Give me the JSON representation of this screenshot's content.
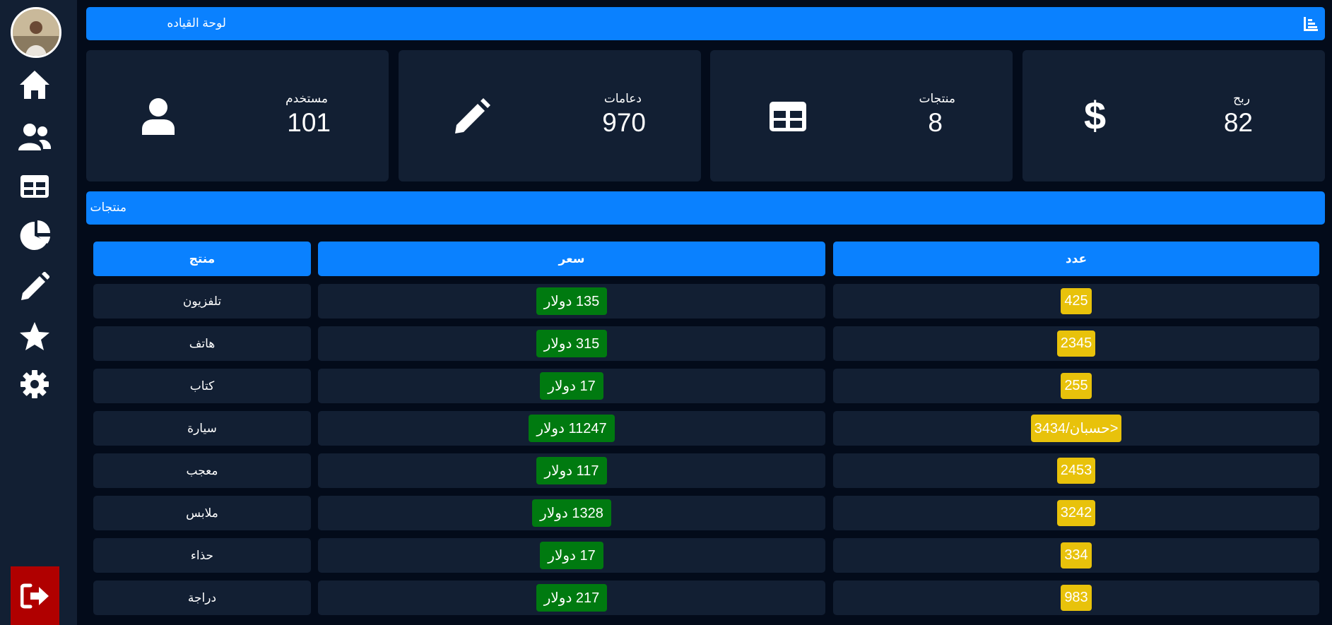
{
  "header": {
    "title": "لوحة القياده",
    "icon": "chart-bar-icon"
  },
  "sidebar": {
    "avatar": "user-avatar",
    "items": [
      {
        "icon": "home-icon"
      },
      {
        "icon": "users-icon"
      },
      {
        "icon": "table-icon"
      },
      {
        "icon": "pie-chart-icon"
      },
      {
        "icon": "pencil-icon"
      },
      {
        "icon": "star-icon"
      },
      {
        "icon": "gear-icon"
      }
    ],
    "logout_icon": "logout-icon"
  },
  "stats": [
    {
      "label": "مستخدم",
      "value": "101",
      "icon": "user-icon"
    },
    {
      "label": "دعامات",
      "value": "970",
      "icon": "pencil-icon"
    },
    {
      "label": "منتجات",
      "value": "8",
      "icon": "table-icon"
    },
    {
      "label": "ربح",
      "value": "82",
      "icon": "dollar-icon"
    }
  ],
  "products_section": {
    "title": "منتجات"
  },
  "table": {
    "headers": {
      "product": "منتج",
      "price": "سعر",
      "count": "عدد"
    },
    "rows": [
      {
        "product": "تلفزيون",
        "price": "135 دولار",
        "count": "425"
      },
      {
        "product": "هاتف",
        "price": "315 دولار",
        "count": "2345"
      },
      {
        "product": "كتاب",
        "price": "17 دولار",
        "count": "255"
      },
      {
        "product": "سيارة",
        "price": "11247 دولار",
        "count": "3434/حسبان>"
      },
      {
        "product": "معجب",
        "price": "117 دولار",
        "count": "2453"
      },
      {
        "product": "ملابس",
        "price": "1328 دولار",
        "count": "3242"
      },
      {
        "product": "حذاء",
        "price": "17 دولار",
        "count": "334"
      },
      {
        "product": "دراجة",
        "price": "217 دولار",
        "count": "983"
      }
    ]
  },
  "colors": {
    "accent": "#0a81ff",
    "card": "#121f33",
    "background": "#030b1a",
    "price_badge": "#007a10",
    "count_badge": "#e8c20b",
    "logout": "#b00000"
  }
}
